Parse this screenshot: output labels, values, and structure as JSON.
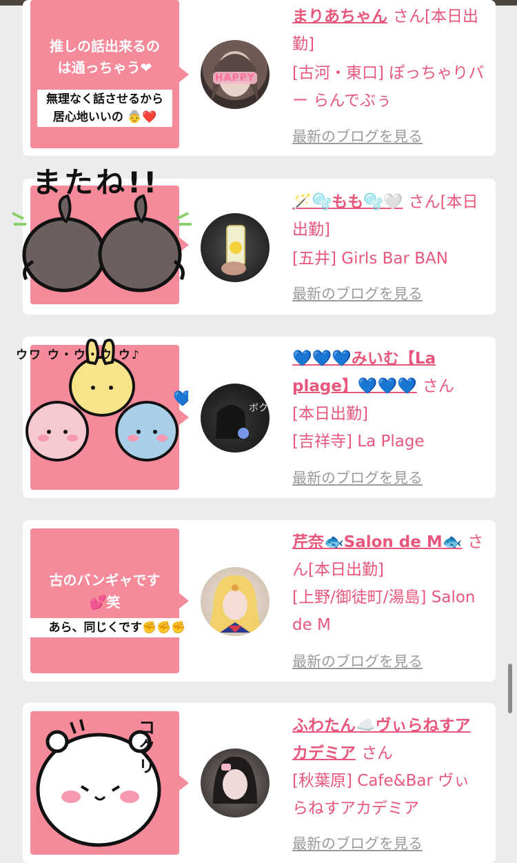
{
  "cards": [
    {
      "bubble_lines": [
        "推しの話出来るの",
        "は通っちゃう❤"
      ],
      "bubble_strip": [
        "無理なく話させるから",
        "居心地いいの 👵❤️"
      ],
      "name": "まりあちゃん",
      "san": "さん",
      "status": "[本日出勤]",
      "shop": "[古河・東口] ぽっちゃりバー らんでぶぅ",
      "blog": "最新のブログを見る",
      "avatar_text": "HAPPY"
    },
    {
      "sticker_text": "またね!!",
      "name": "🪄🫧もも🫧🤍",
      "san": "さん",
      "status": "[本日出勤]",
      "shop": "[五井] Girls Bar BAN",
      "blog": "最新のブログを見る"
    },
    {
      "name": "💙💙💙みいむ【La plage】💙💙💙",
      "san": "さん",
      "status": "[本日出勤]",
      "shop": "[吉祥寺] La Plage",
      "blog": "最新のブログを見る",
      "sticker_text": "ウワ ウ・ウ・ウ ウ♪"
    },
    {
      "bubble_lines": [
        "古のバンギャです",
        "💕笑"
      ],
      "bubble_strip": [
        "あら、同じくです✊✊✊"
      ],
      "name": "芹奈🐟Salon de M🐟",
      "san": "さん",
      "status": "[本日出勤]",
      "shop": "[上野/御徒町/湯島] Salon de M",
      "blog": "最新のブログを見る"
    },
    {
      "sticker_text": "コクリ",
      "name": "ふわたん☁️ヴぃらねすアカデミア",
      "san": "さん",
      "shop": "[秋葉原] Cafe&Bar ヴぃらねすアカデミア",
      "blog": "最新のブログを見る"
    }
  ],
  "colors": {
    "accent": "#e8577b",
    "bubble": "#f48a9a",
    "background": "#ececec",
    "link_gray": "#9a9a9a"
  }
}
